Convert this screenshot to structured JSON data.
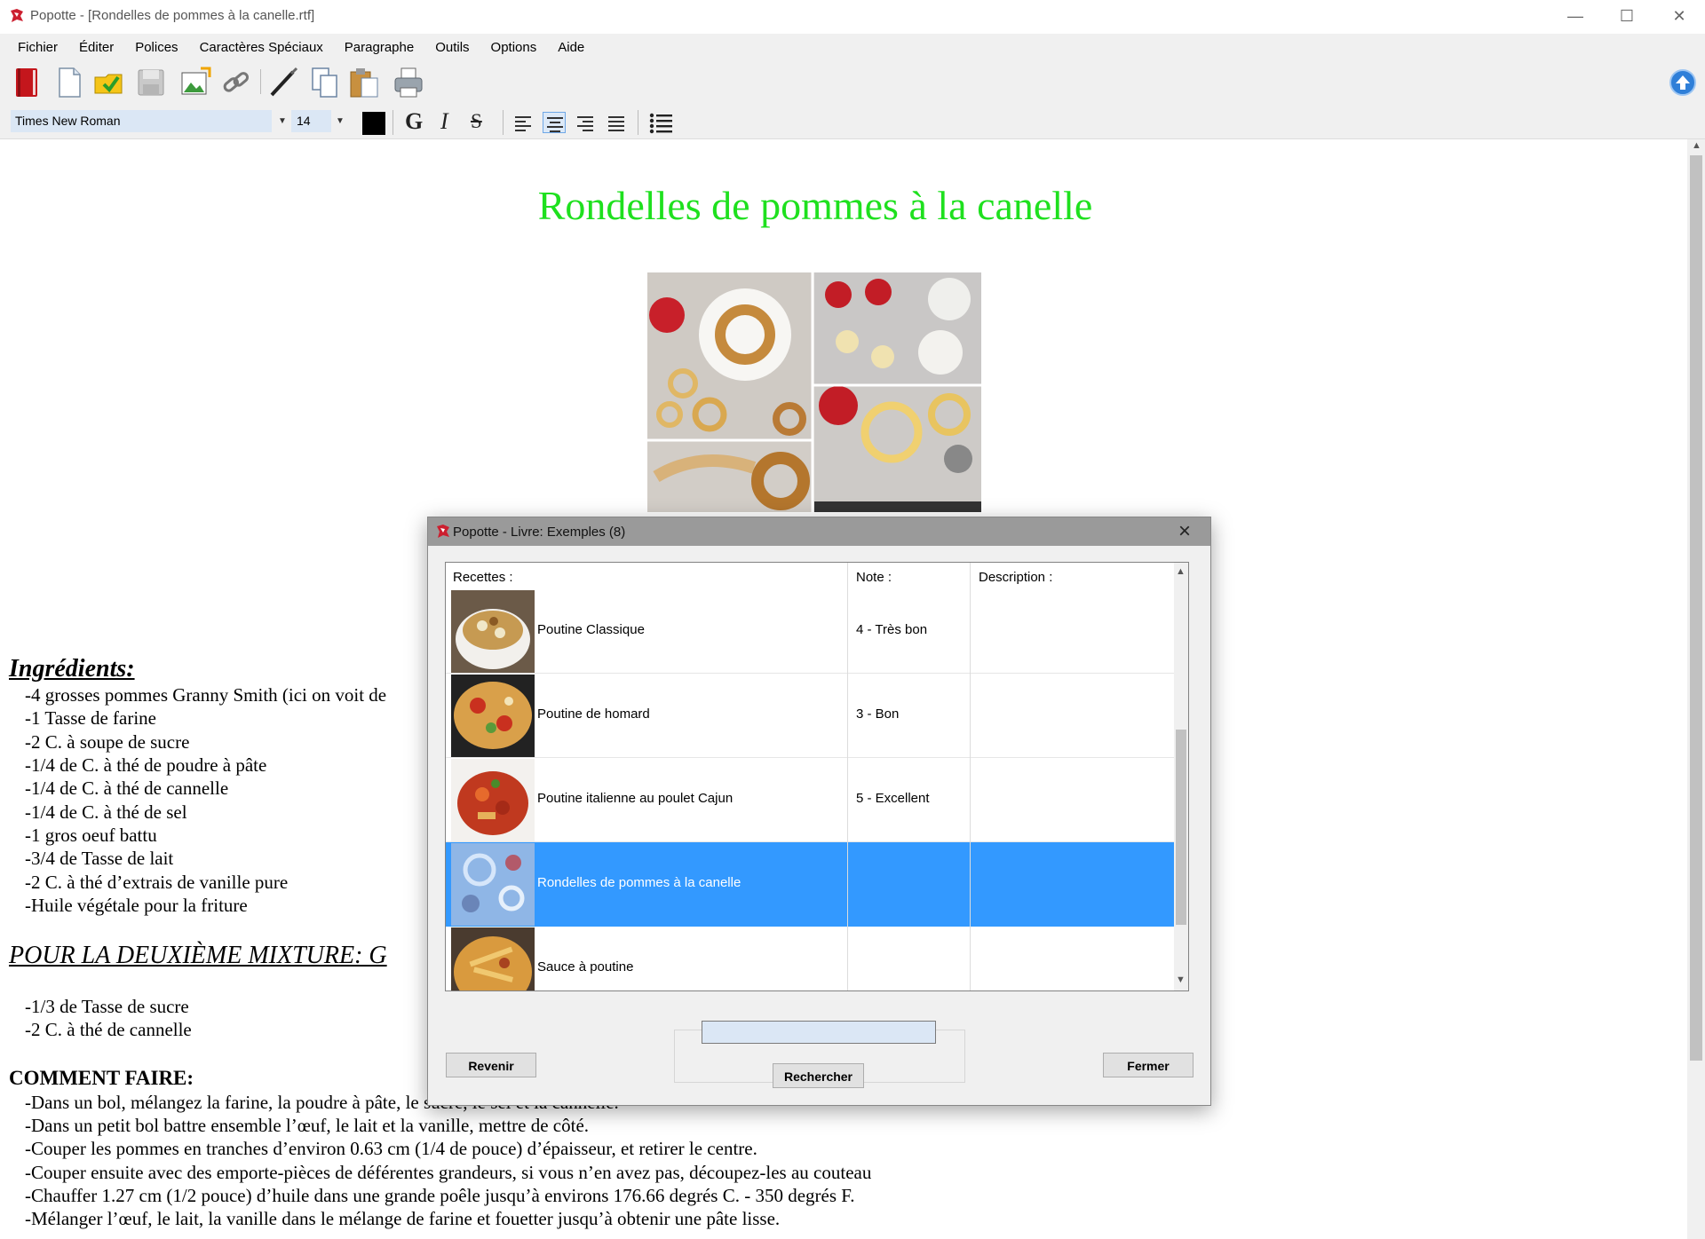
{
  "window": {
    "title": "Popotte - [Rondelles de pommes à la canelle.rtf]",
    "minimize": "—",
    "maximize": "☐",
    "close": "✕"
  },
  "menu": [
    "Fichier",
    "Éditer",
    "Polices",
    "Caractères Spéciaux",
    "Paragraphe",
    "Outils",
    "Options",
    "Aide"
  ],
  "format": {
    "font": "Times New Roman",
    "size": "14",
    "bold": "G",
    "italic": "I",
    "strike": "S",
    "text_color": "#000000"
  },
  "document": {
    "title": "Rondelles de pommes à la canelle",
    "title_color": "#1ee01e",
    "ingredients_heading": "Ingrédients:",
    "ingredients": [
      "-4 grosses pommes Granny Smith (ici on voit de",
      "-1 Tasse de farine",
      "-2 C. à soupe de sucre",
      "-1/4 de C. à thé de poudre à pâte",
      "-1/4 de C. à thé de cannelle",
      "-1/4 de C. à thé de sel",
      "-1 gros oeuf battu",
      "-3/4 de Tasse de lait",
      "-2 C. à thé d’extrais de vanille pure",
      "-Huile végétale pour  la friture"
    ],
    "second_mixture_heading": "POUR LA DEUXIÈME MIXTURE:  G",
    "second_mixture": [
      "-1/3 de Tasse de sucre",
      "-2 C. à thé de cannelle"
    ],
    "method_heading": "COMMENT FAIRE:",
    "method": [
      "-Dans un bol, mélangez la farine, la poudre à pâte, le sucre, le sel et la cannelle.",
      "-Dans un petit bol battre ensemble l’œuf, le lait et la vanille, mettre de côté.",
      "-Couper les pommes en tranches d’environ 0.63 cm (1/4 de pouce) d’épaisseur, et retirer le centre.",
      "-Couper ensuite avec des emporte-pièces de déférentes grandeurs, si vous n’en avez pas, découpez-les au couteau",
      "-Chauffer 1.27 cm (1/2 pouce) d’huile dans une grande poêle jusqu’à environs 176.66 degrés C. - 350 degrés F.",
      "-Mélanger l’œuf, le lait, la vanille dans le mélange de farine et fouetter jusqu’à obtenir une pâte lisse."
    ]
  },
  "dialog": {
    "title": "Popotte - Livre: Exemples (8)",
    "columns": {
      "recipes": "Recettes :",
      "note": "Note :",
      "description": "Description :"
    },
    "rows": [
      {
        "name": "Poutine Classique",
        "note": "4 - Très bon",
        "description": ""
      },
      {
        "name": "Poutine de homard",
        "note": "3 - Bon",
        "description": ""
      },
      {
        "name": "Poutine italienne au poulet Cajun",
        "note": "5 - Excellent",
        "description": ""
      },
      {
        "name": "Rondelles de pommes à la canelle",
        "note": "",
        "description": ""
      },
      {
        "name": "Sauce à poutine",
        "note": "",
        "description": ""
      }
    ],
    "selected_row": 3,
    "search_value": "",
    "buttons": {
      "back": "Revenir",
      "search": "Rechercher",
      "close": "Fermer"
    }
  },
  "colors": {
    "selection": "#3399ff",
    "accent": "#2f7fd8"
  }
}
